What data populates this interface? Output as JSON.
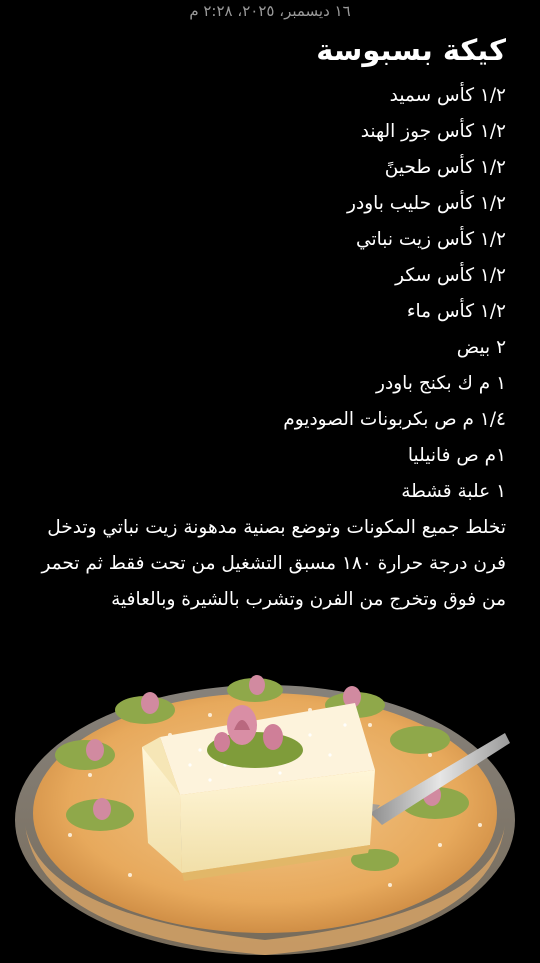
{
  "note": {
    "timestamp": "١٦ ديسمبر، ٢٠٢٥، ٢:٢٨ م",
    "title": "كيكة بسبوسة",
    "ingredients": [
      "١/٢ كأس سميد",
      "١/٢ كأس جوز الهند",
      "١/٢ كأس طحينً",
      "١/٢ كأس حليب باودر",
      "١/٢ كأس زيت نباتي",
      "١/٢ كأس سكر",
      "١/٢ كأس ماء",
      "٢ بيض",
      "١ م ك بكنج باودر",
      "١/٤ م ص بكربونات الصوديوم",
      "١م ص فانيليا",
      "١ علبة قشطة"
    ],
    "method": "تخلط جميع المكونات وتوضع بصنية مدهونة زيت نباتي وتدخل فرن درجة حرارة ١٨٠ مسبق التشغيل من تحت فقط ثم تحمر من فوق وتخرج من الفرن وتشرب بالشيرة وبالعافية"
  },
  "colors": {
    "background": "#000000",
    "text": "#ffffff",
    "timestamp": "#9a9a9a"
  }
}
